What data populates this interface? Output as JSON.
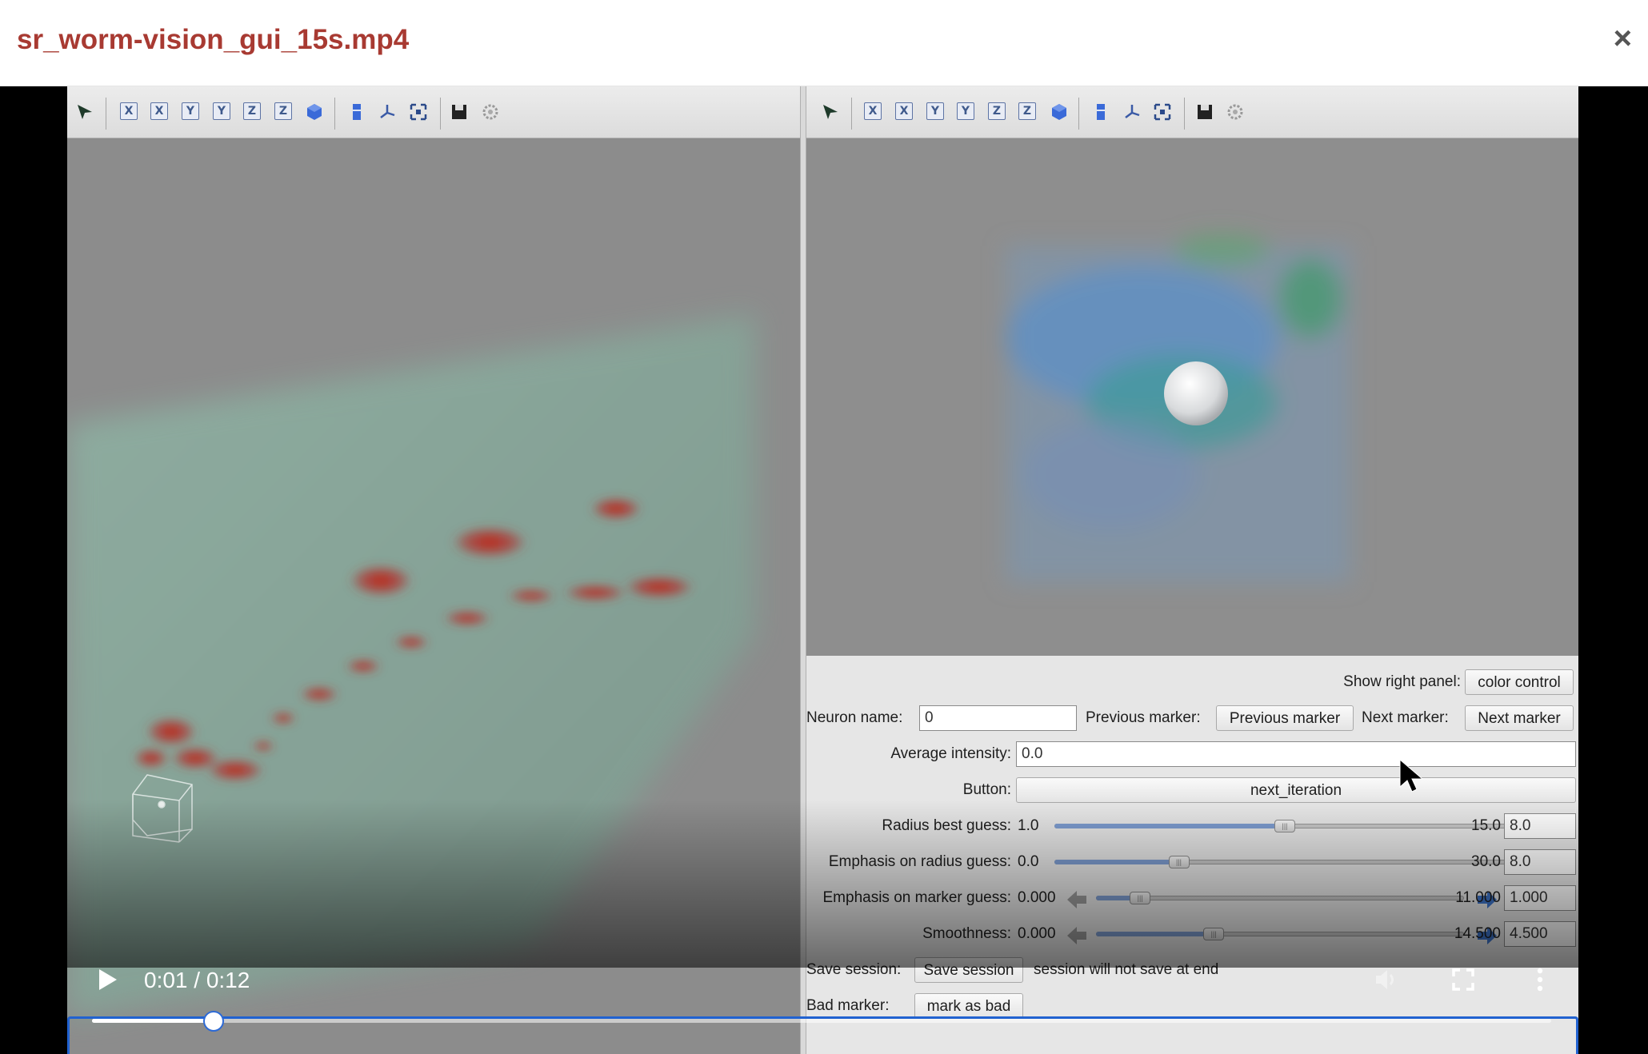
{
  "modal": {
    "title": "sr_worm-vision_gui_15s.mp4",
    "close_label": "×"
  },
  "toolbar": {
    "icons": [
      "pointer-icon",
      "x-axis-icon",
      "x-axis-flip-icon",
      "y-axis-icon",
      "y-axis-flip-icon",
      "z-axis-icon",
      "z-axis-flip-icon",
      "cube-icon",
      "column-icon",
      "axes-icon",
      "fit-icon",
      "save-icon",
      "settings-icon"
    ],
    "axis_letters": [
      "X",
      "X",
      "Y",
      "Y",
      "Z",
      "Z"
    ]
  },
  "panel": {
    "show_right_panel_label": "Show right panel:",
    "color_control_button": "color control",
    "neuron_name_label": "Neuron name:",
    "neuron_name_value": "0",
    "previous_marker_label": "Previous marker:",
    "previous_marker_button": "Previous marker",
    "next_marker_label": "Next marker:",
    "next_marker_button": "Next marker",
    "average_intensity_label": "Average intensity:",
    "average_intensity_value": "0.0",
    "button_label": "Button:",
    "next_iteration_button": "next_iteration",
    "sliders": [
      {
        "label": "Radius best guess:",
        "min": "1.0",
        "max": "15.0",
        "value": "8.0",
        "fraction": 0.5,
        "arrows": false
      },
      {
        "label": "Emphasis on radius guess:",
        "min": "0.0",
        "max": "30.0",
        "value": "8.0",
        "fraction": 0.27,
        "arrows": false
      },
      {
        "label": "Emphasis on marker guess:",
        "min": "0.000",
        "max": "11.000",
        "value": "1.000",
        "fraction": 0.12,
        "arrows": true
      },
      {
        "label": "Smoothness:",
        "min": "0.000",
        "max": "14.500",
        "value": "4.500",
        "fraction": 0.32,
        "arrows": true
      }
    ],
    "save_session_label": "Save session:",
    "save_session_button": "Save session",
    "save_session_status": "session will not save at end",
    "bad_marker_label": "Bad marker:",
    "mark_as_bad_button": "mark as bad"
  },
  "video": {
    "time": "0:01 / 0:12",
    "progress_fraction": 0.0833
  }
}
